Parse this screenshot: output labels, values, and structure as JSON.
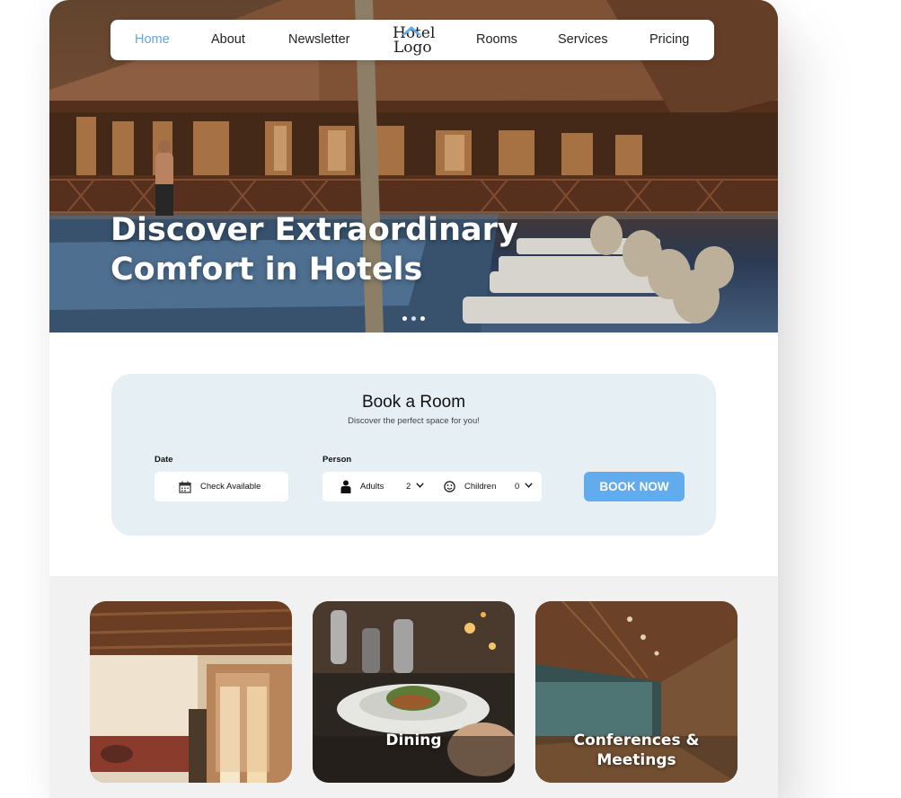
{
  "nav": {
    "items": [
      {
        "label": "Home",
        "active": true
      },
      {
        "label": "About"
      },
      {
        "label": "Newsletter"
      },
      {
        "label": "Rooms"
      },
      {
        "label": "Services"
      },
      {
        "label": "Pricing"
      }
    ],
    "logo": {
      "line1": "Hotel",
      "line2": "Logo",
      "icon": "house-roof-icon"
    }
  },
  "hero": {
    "title_line1": "Discover Extraordinary",
    "title_line2": "Comfort in Hotels",
    "carousel_dots": 3
  },
  "booking": {
    "title": "Book a Room",
    "subtitle": "Discover the perfect space for you!",
    "date_label": "Date",
    "date_value": "Check Available",
    "date_icon": "calendar-icon",
    "person_label": "Person",
    "adults_label": "Adults",
    "adults_value": "2",
    "adults_icon": "person-icon",
    "children_label": "Children",
    "children_value": "0",
    "children_icon": "smiley-icon",
    "button": "BOOK NOW"
  },
  "gallery": {
    "tiles": [
      {
        "label": ""
      },
      {
        "label": "Dining"
      },
      {
        "label": "Conferences &\nMeetings"
      }
    ]
  },
  "colors": {
    "accent": "#62aced",
    "nav_active": "#62a6ea",
    "booking_bg": "#e6eff4",
    "gallery_bg": "#f1f1f1"
  }
}
